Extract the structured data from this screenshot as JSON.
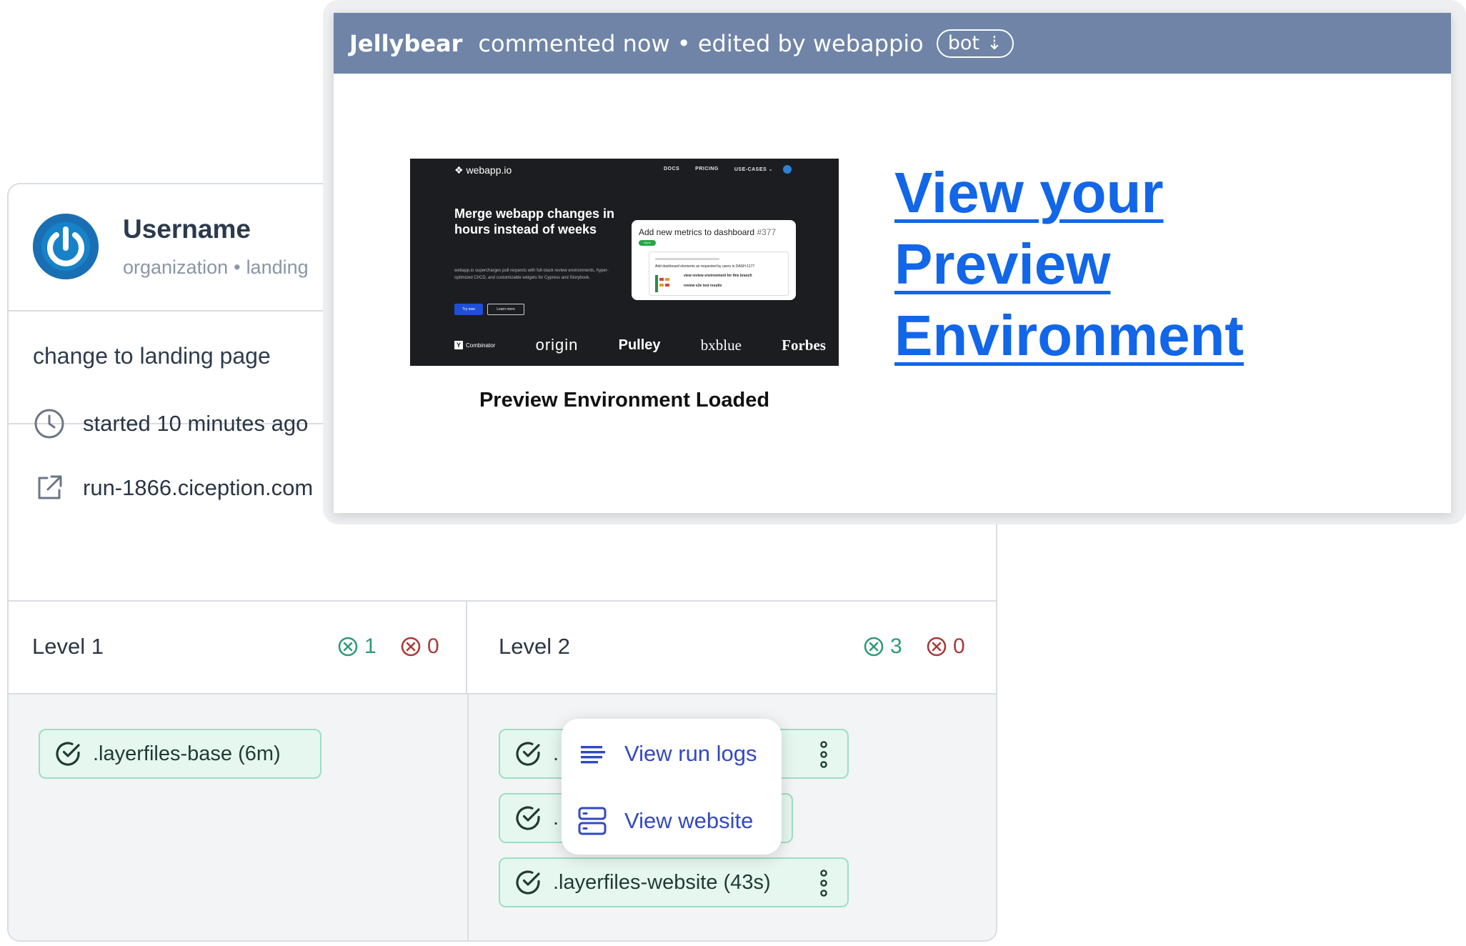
{
  "run": {
    "username": "Username",
    "org": "organization",
    "branch": "landing",
    "commit_message": "change to landing page",
    "started": "started 10 minutes ago",
    "url": "run-1866.ciception.com"
  },
  "levels": [
    {
      "title": "Level 1",
      "passed": "1",
      "failed": "0"
    },
    {
      "title": "Level 2",
      "passed": "3",
      "failed": "0"
    }
  ],
  "jobs": {
    "level1": [
      {
        "label": ".layerfiles-base (6m)"
      }
    ],
    "level2": [
      {
        "label": "."
      },
      {
        "label": "."
      },
      {
        "label": ".layerfiles-website (43s)"
      }
    ]
  },
  "menu": {
    "items": [
      {
        "label": "View run logs",
        "icon": "list-lines-icon"
      },
      {
        "label": "View website",
        "icon": "server-stack-icon"
      }
    ]
  },
  "comment": {
    "author": "Jellybear",
    "action": "commented now • edited by webappio",
    "badge": "bot",
    "badge_icon": "arrow-down-icon",
    "link_text": "View your Preview Environment",
    "caption": "Preview Environment Loaded"
  },
  "screenshot": {
    "logo": "webapp.io",
    "nav": [
      "DOCS",
      "PRICING",
      "USE-CASES ⌄"
    ],
    "headline": "Merge webapp changes in hours instead of weeks",
    "subtext": "webapp.io supercharges pull requests with full-stack review environments, hyper-optimized CI/CD, and customizable widgets for Cypress and Storybook.",
    "btn_primary": "Try now",
    "btn_secondary": "Learn more",
    "mock_title": "Add new metrics to dashboard",
    "mock_number": "#377",
    "mock_tag": "Open",
    "mock_line1": "Add dashboard elements as requested by users in DASH-1177",
    "mock_line2": "view review environment for this branch",
    "mock_line3": "review e2e test results",
    "logos": {
      "yc": "Combinator",
      "yc_mark": "Y",
      "origin": "origin",
      "pulley": "Pulley",
      "bxblue": "bxblue",
      "forbes": "Forbes"
    }
  },
  "colors": {
    "comment_bar": "#6f84a6",
    "link": "#1266e8",
    "job_pill_bg": "#e6f7ef",
    "job_pill_border": "#9ddfc2",
    "status_ok": "#2f9a77",
    "status_err": "#a83a3a",
    "menu_text": "#3249c4",
    "avatar": "#1a6fb4"
  }
}
